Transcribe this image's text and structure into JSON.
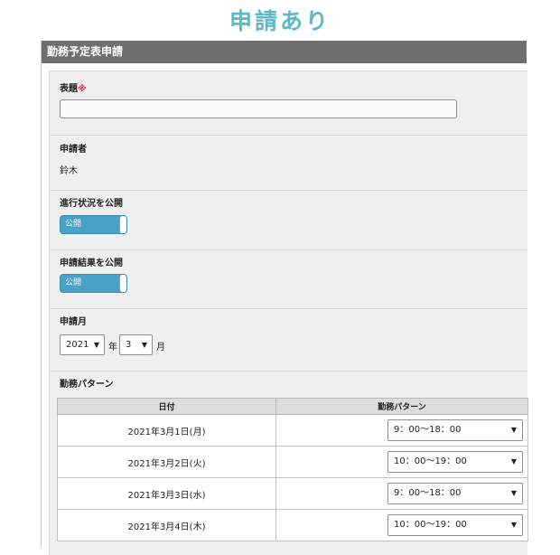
{
  "heading": "申請あり",
  "panel": {
    "title": "勤務予定表申請"
  },
  "form": {
    "title_label": "表題",
    "required_mark": "※",
    "title_value": "",
    "applicant_label": "申請者",
    "applicant_value": "鈴木",
    "progress_label": "進行状況を公開",
    "progress_toggle": "公開",
    "result_label": "申請結果を公開",
    "result_toggle": "公開",
    "month_label": "申請月",
    "year_value": "2021",
    "year_unit": "年",
    "month_value": "3",
    "month_unit": "月",
    "pattern_label": "勤務パターン"
  },
  "table": {
    "headers": [
      "日付",
      "勤務パターン"
    ],
    "rows": [
      {
        "date": "2021年3月1日(月)",
        "pattern": "9：00〜18：00"
      },
      {
        "date": "2021年3月2日(火)",
        "pattern": "10：00〜19：00"
      },
      {
        "date": "2021年3月3日(水)",
        "pattern": "9：00〜18：00"
      },
      {
        "date": "2021年3月4日(木)",
        "pattern": "10：00〜19：00"
      }
    ]
  },
  "icons": {
    "dropdown": "chevron-down-icon",
    "arrow_glyph": "▼"
  },
  "colors": {
    "heading": "#5cb8c5",
    "header_bg": "#6f6f6f",
    "toggle_on": "#48a1c9",
    "required": "#d9304a"
  }
}
